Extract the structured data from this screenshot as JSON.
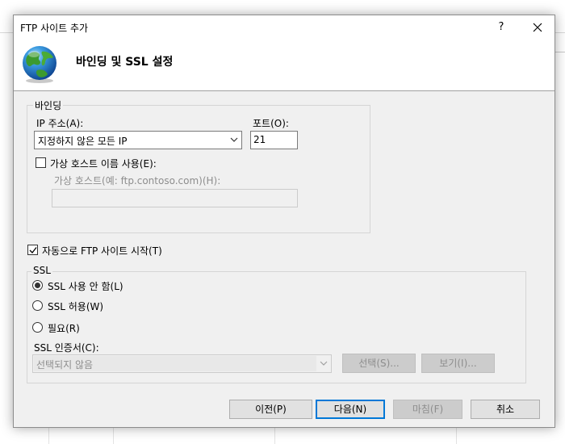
{
  "dialog": {
    "title": "FTP 사이트 추가",
    "help_label": "?",
    "header_title": "바인딩 및 SSL 설정"
  },
  "binding": {
    "legend": "바인딩",
    "ip_label": "IP 주소(A):",
    "ip_value": "지정하지 않은 모든 IP",
    "port_label": "포트(O):",
    "port_value": "21",
    "vhost_checkbox_label": "가상 호스트 이름 사용(E):",
    "vhost_checked": false,
    "vhost_field_label": "가상 호스트(예: ftp.contoso.com)(H):",
    "vhost_value": ""
  },
  "autostart": {
    "label": "자동으로 FTP 사이트 시작(T)",
    "checked": true
  },
  "ssl": {
    "legend": "SSL",
    "options": [
      {
        "label": "SSL 사용 안 함(L)",
        "selected": true
      },
      {
        "label": "SSL 허용(W)",
        "selected": false
      },
      {
        "label": "필요(R)",
        "selected": false
      }
    ],
    "cert_label": "SSL 인증서(C):",
    "cert_value": "선택되지 않음",
    "select_button": "선택(S)...",
    "view_button": "보기(I)..."
  },
  "footer": {
    "prev": "이전(P)",
    "next": "다음(N)",
    "finish": "마침(F)",
    "cancel": "취소"
  },
  "colors": {
    "accent": "#0078d7",
    "dialog_bg": "#f0f0f0"
  }
}
